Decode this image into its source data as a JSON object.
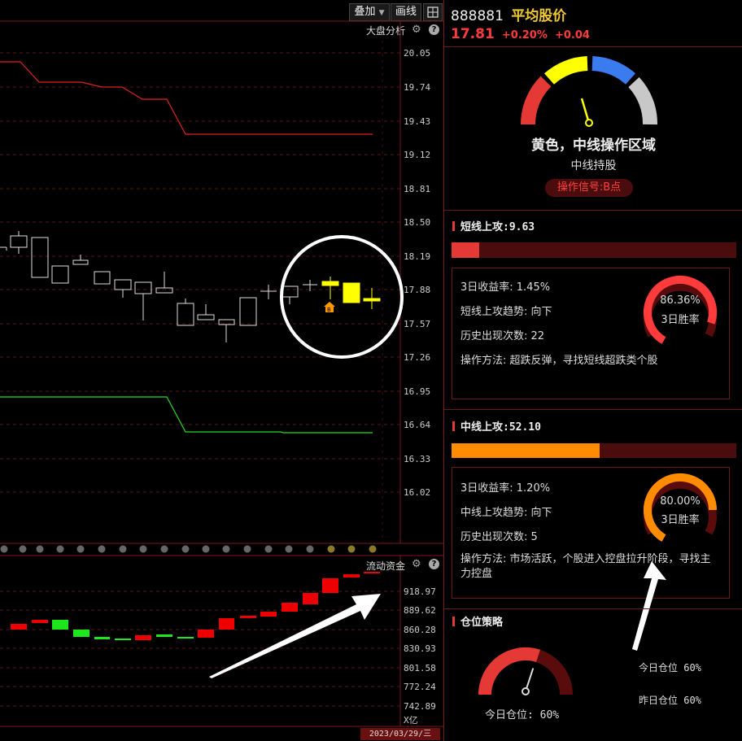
{
  "toolbar": {
    "overlay_label": "叠加",
    "draw_label": "画线"
  },
  "main_chart": {
    "indicator_label": "大盘分析",
    "price_ticks": [
      "20.05",
      "19.74",
      "19.43",
      "19.12",
      "18.81",
      "18.50",
      "18.19",
      "17.88",
      "17.57",
      "17.26",
      "16.95",
      "16.64",
      "16.33",
      "16.02"
    ]
  },
  "sub_chart": {
    "indicator_label": "流动资金",
    "ticks": [
      "918.97",
      "889.62",
      "860.28",
      "830.93",
      "801.58",
      "772.24",
      "742.89"
    ],
    "unit": "X亿",
    "date": "2023/03/29/三"
  },
  "colors": {
    "up": "#e53935",
    "down": "#1ee61e",
    "highlight": "#ffff00",
    "gauge_red": "#e53935",
    "gauge_yellow": "#ffff00",
    "gauge_blue": "#3a7bf0",
    "gauge_gray": "#c8c8c8",
    "short_bar": "#e53935",
    "mid_bar": "#ff8c00"
  },
  "stock": {
    "code": "888881",
    "name": "平均股价",
    "price": "17.81",
    "change_pct": "+0.20%",
    "change_abs": "+0.04"
  },
  "status": {
    "zone_text": "黄色，中线操作区域",
    "action": "中线持股",
    "signal": "操作信号:B点"
  },
  "short_term": {
    "title": "短线上攻:9.63",
    "score": 9.63,
    "return_3d": "3日收益率: 1.45%",
    "trend": "短线上攻趋势: 向下",
    "history": "历史出现次数: 22",
    "method": "操作方法: 超跌反弹，寻找短线超跌类个股",
    "winrate": "86.36%",
    "winrate_value": 86.36,
    "winrate_label": "3日胜率"
  },
  "mid_term": {
    "title": "中线上攻:52.10",
    "score": 52.1,
    "return_3d": "3日收益率: 1.20%",
    "trend": "中线上攻趋势: 向下",
    "history": "历史出现次数: 5",
    "method": "操作方法: 市场活跃，个股进入控盘拉升阶段，寻找主力控盘",
    "winrate": "80.00%",
    "winrate_value": 80.0,
    "winrate_label": "3日胜率"
  },
  "position": {
    "title": "仓位策略",
    "gauge_label": "今日仓位: 60%",
    "gauge_value": 60,
    "today": "今日仓位 60%",
    "yesterday": "昨日仓位 60%"
  }
}
